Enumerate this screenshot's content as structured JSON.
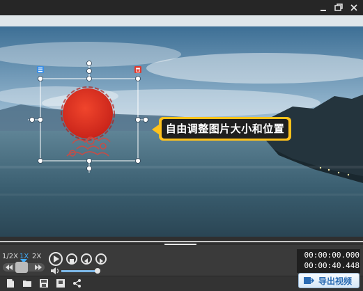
{
  "window": {
    "minimize_icon": "minimize-icon",
    "restore_icon": "restore-icon",
    "close_icon": "close-icon"
  },
  "canvas": {
    "callout_text": "自由调整图片大小和位置",
    "accent_color": "#ffc21c"
  },
  "speed": {
    "options": [
      "1/2X",
      "1X",
      "2X"
    ],
    "selected": "1X"
  },
  "player": {
    "current_time": "00:00:00.000",
    "total_time": "00:00:40.448"
  },
  "toolbar": {
    "export_label": "导出视频"
  }
}
